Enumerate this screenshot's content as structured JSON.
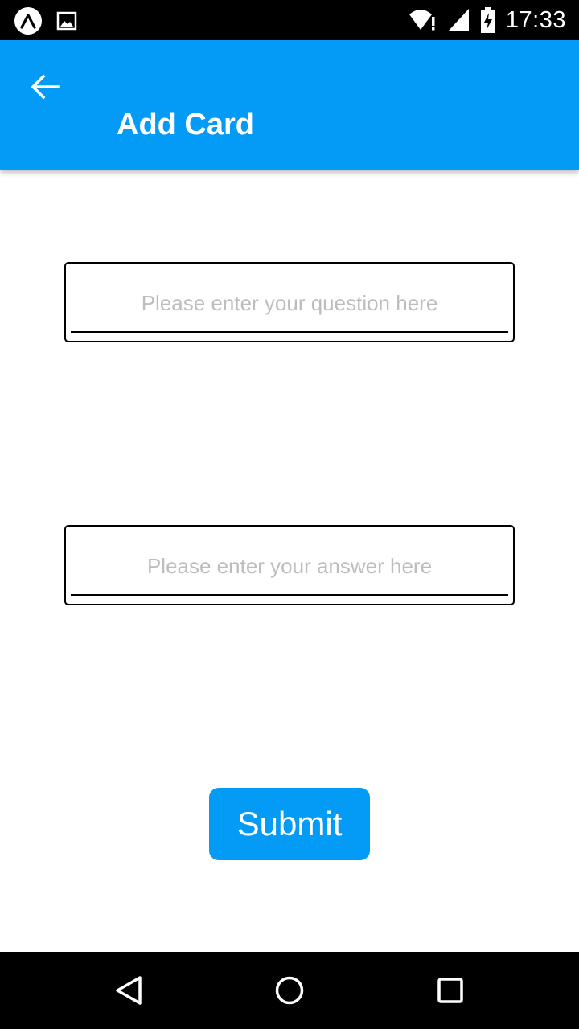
{
  "status_bar": {
    "time": "17:33",
    "left_icons": [
      "expo-icon",
      "image-icon"
    ],
    "right_icons": [
      "wifi-alert-icon",
      "signal-icon",
      "battery-charging-icon"
    ]
  },
  "app_bar": {
    "title": "Add Card",
    "back_icon": "arrow-left-icon",
    "color": "#039BF6"
  },
  "form": {
    "question_input": {
      "value": "",
      "placeholder": "Please enter your question here"
    },
    "answer_input": {
      "value": "",
      "placeholder": "Please enter your answer here"
    },
    "submit_label": "Submit"
  },
  "nav_bar": {
    "icons": [
      "back-triangle-icon",
      "home-circle-icon",
      "recents-square-icon"
    ]
  }
}
